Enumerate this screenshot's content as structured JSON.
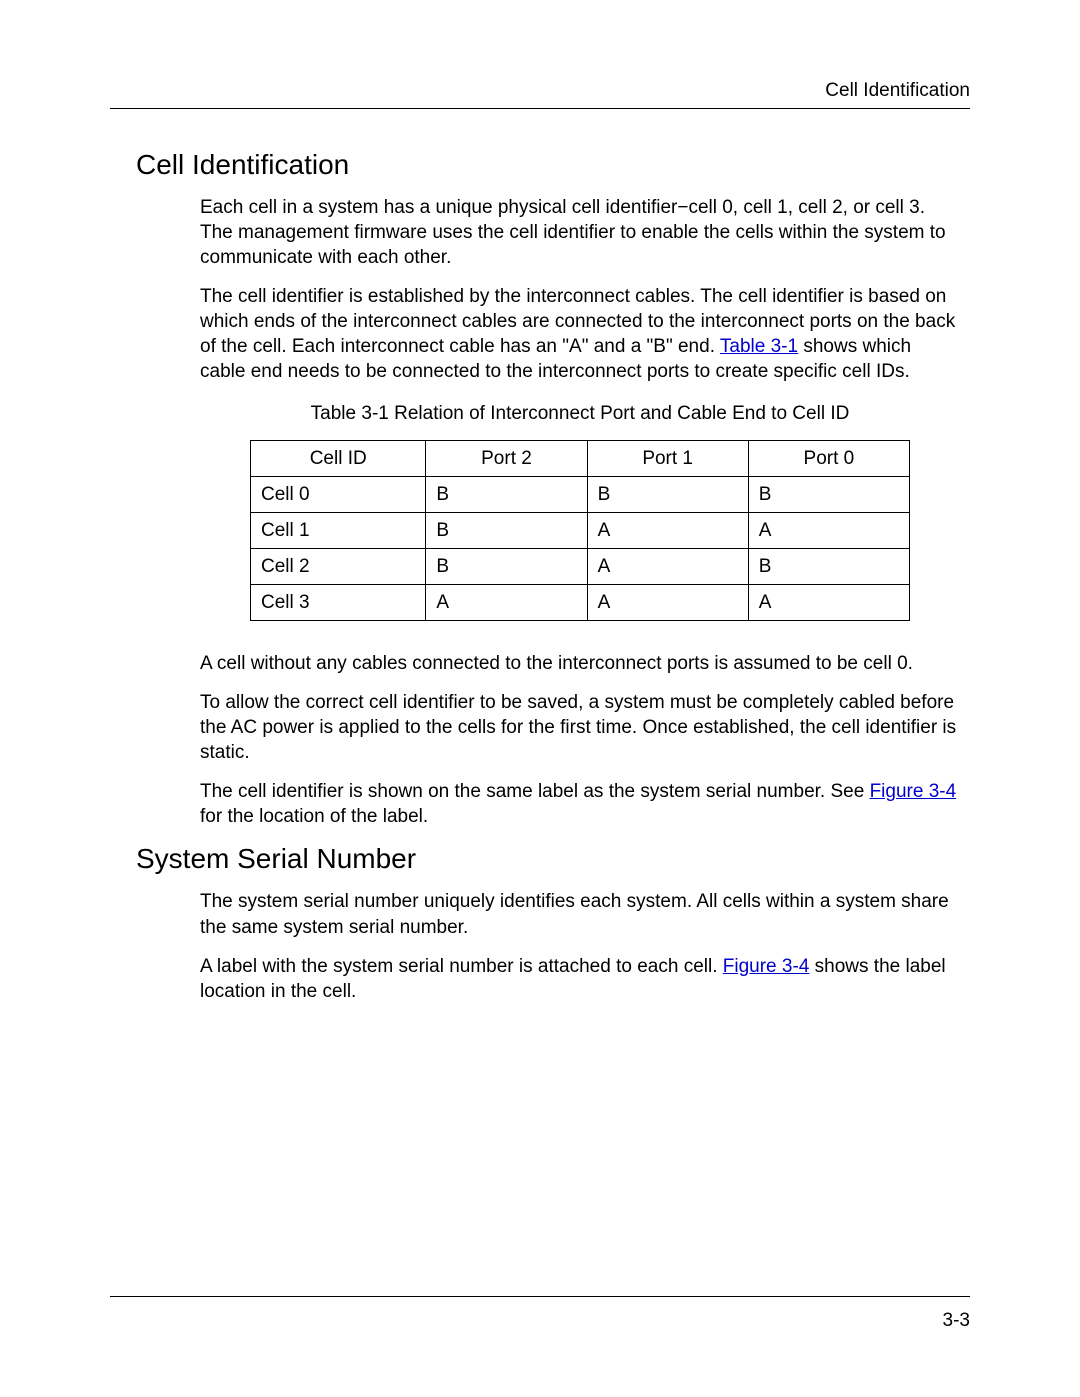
{
  "header": {
    "running_title": "Cell Identification"
  },
  "section1": {
    "heading": "Cell Identification",
    "para1": "Each cell in a system has a unique physical cell identifier−cell 0, cell 1, cell 2, or cell 3. The management firmware uses the cell identifier to enable the cells within the system to communicate with each other.",
    "para2_pre": "The cell identifier is established by the interconnect cables. The cell identifier is based on which ends of the interconnect cables are connected to the interconnect ports on the back of the cell. Each interconnect cable has an \"A\" and a \"B\" end. ",
    "para2_link": "Table 3-1",
    "para2_post": " shows which cable end needs to be connected to the interconnect ports to create specific cell IDs.",
    "table_caption": "Table 3-1 Relation of Interconnect Port and Cable End to Cell ID",
    "table": {
      "headers": [
        "Cell ID",
        "Port 2",
        "Port 1",
        "Port 0"
      ],
      "rows": [
        [
          "Cell 0",
          "B",
          "B",
          "B"
        ],
        [
          "Cell 1",
          "B",
          "A",
          "A"
        ],
        [
          "Cell 2",
          "B",
          "A",
          "B"
        ],
        [
          "Cell 3",
          "A",
          "A",
          "A"
        ]
      ]
    },
    "para3": "A cell without any cables connected to the interconnect ports is assumed to be cell 0.",
    "para4": "To allow the correct cell identifier to be saved, a system must be completely cabled before the AC power is applied to the cells for the first time. Once established, the cell identifier is static.",
    "para5_pre": "The cell identifier is shown on the same label as the system serial number. See ",
    "para5_link": "Figure 3-4",
    "para5_post": " for the location of the label."
  },
  "section2": {
    "heading": "System Serial Number",
    "para1": "The system serial number uniquely identifies each system. All cells within a system share the same system serial number.",
    "para2_pre": "A label with the system serial number is attached to each cell. ",
    "para2_link": "Figure 3-4",
    "para2_post": " shows the label location in the cell."
  },
  "footer": {
    "page_number": "3-3"
  }
}
